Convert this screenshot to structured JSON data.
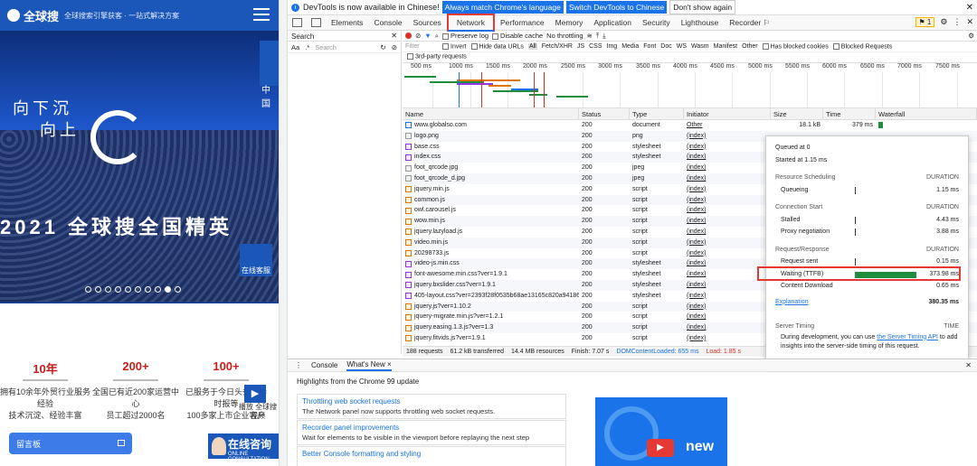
{
  "site": {
    "logo": "全球搜",
    "tagline": "全球搜索引擎获客 · 一站式解决方案",
    "hero": {
      "line1": "向下沉",
      "line2": "向上",
      "banner": "2021 全球搜全国精英",
      "online_service": "在线客服"
    },
    "side_lang": "中国",
    "stats": [
      {
        "badge": "10年",
        "line1": "拥有10余年外贸行业服务",
        "line2": "经验",
        "line3": "技术沉淀、经验丰富"
      },
      {
        "badge": "200+",
        "line1": "全国已有近200家运营中",
        "line2": "心",
        "line3": "员工超过2000名"
      },
      {
        "badge": "100+",
        "line1": "已服务于今日头条、华",
        "line2": "时报等",
        "line3": "100多家上市企业客户"
      }
    ],
    "play_label": "播放 全球搜视频",
    "message_button": "留言板",
    "consult": {
      "title": "在线咨询",
      "sub": "ONLINE CONSULTATION"
    }
  },
  "devtools": {
    "infobar": {
      "text": "DevTools is now available in Chinese!",
      "btn_match": "Always match Chrome's language",
      "btn_switch": "Switch DevTools to Chinese",
      "btn_dont": "Don't show again"
    },
    "tabs": [
      "Elements",
      "Console",
      "Sources",
      "Network",
      "Performance",
      "Memory",
      "Application",
      "Security",
      "Lighthouse",
      "Recorder ⚐"
    ],
    "issues_count": "1",
    "search_pane": {
      "title": "Search",
      "placeholder": "Search"
    },
    "toolbar": {
      "preserve_log": "Preserve log",
      "disable_cache": "Disable cache",
      "throttling": "No throttling"
    },
    "filter": {
      "label": "Filter",
      "invert": "Invert",
      "hide_data": "Hide data URLs",
      "types": [
        "All",
        "Fetch/XHR",
        "JS",
        "CSS",
        "Img",
        "Media",
        "Font",
        "Doc",
        "WS",
        "Wasm",
        "Manifest",
        "Other"
      ],
      "blocked_cookies": "Has blocked cookies",
      "blocked_requests": "Blocked Requests",
      "third_party": "3rd-party requests"
    },
    "overview_ticks": [
      "500 ms",
      "1000 ms",
      "1500 ms",
      "2000 ms",
      "2500 ms",
      "3000 ms",
      "3500 ms",
      "4000 ms",
      "4500 ms",
      "5000 ms",
      "5500 ms",
      "6000 ms",
      "6500 ms",
      "7000 ms",
      "7500 ms"
    ],
    "columns": {
      "name": "Name",
      "status": "Status",
      "type": "Type",
      "initiator": "Initiator",
      "size": "Size",
      "time": "Time",
      "waterfall": "Waterfall"
    },
    "rows": [
      {
        "name": "www.globalso.com",
        "status": "200",
        "type": "document",
        "initiator": "Other",
        "size": "18.1 kB",
        "time": "379 ms"
      },
      {
        "name": "logo.png",
        "status": "200",
        "type": "png",
        "initiator": "(index)",
        "size": "",
        "time": ""
      },
      {
        "name": "base.css",
        "status": "200",
        "type": "stylesheet",
        "initiator": "(index)",
        "size": "",
        "time": ""
      },
      {
        "name": "index.css",
        "status": "200",
        "type": "stylesheet",
        "initiator": "(index)",
        "size": "",
        "time": ""
      },
      {
        "name": "foot_qrcode.jpg",
        "status": "200",
        "type": "jpeg",
        "initiator": "(index)",
        "size": "",
        "time": ""
      },
      {
        "name": "foot_qrcode_d.jpg",
        "status": "200",
        "type": "jpeg",
        "initiator": "(index)",
        "size": "",
        "time": ""
      },
      {
        "name": "jquery.min.js",
        "status": "200",
        "type": "script",
        "initiator": "(index)",
        "size": "",
        "time": ""
      },
      {
        "name": "common.js",
        "status": "200",
        "type": "script",
        "initiator": "(index)",
        "size": "",
        "time": ""
      },
      {
        "name": "owl.carousel.js",
        "status": "200",
        "type": "script",
        "initiator": "(index)",
        "size": "",
        "time": ""
      },
      {
        "name": "wow.min.js",
        "status": "200",
        "type": "script",
        "initiator": "(index)",
        "size": "",
        "time": ""
      },
      {
        "name": "jquery.lazyload.js",
        "status": "200",
        "type": "script",
        "initiator": "(index)",
        "size": "",
        "time": ""
      },
      {
        "name": "video.min.js",
        "status": "200",
        "type": "script",
        "initiator": "(index)",
        "size": "",
        "time": ""
      },
      {
        "name": "20298733.js",
        "status": "200",
        "type": "script",
        "initiator": "(index)",
        "size": "",
        "time": ""
      },
      {
        "name": "video-js.min.css",
        "status": "200",
        "type": "stylesheet",
        "initiator": "(index)",
        "size": "",
        "time": ""
      },
      {
        "name": "font-awesome.min.css?ver=1.9.1",
        "status": "200",
        "type": "stylesheet",
        "initiator": "(index)",
        "size": "",
        "time": ""
      },
      {
        "name": "jquery.bxslider.css?ver=1.9.1",
        "status": "200",
        "type": "stylesheet",
        "initiator": "(index)",
        "size": "",
        "time": ""
      },
      {
        "name": "405-layout.css?ver=2393f28f0535b68ae13165c820a94186",
        "status": "200",
        "type": "stylesheet",
        "initiator": "(index)",
        "size": "",
        "time": ""
      },
      {
        "name": "jquery.js?ver=1.10.2",
        "status": "200",
        "type": "script",
        "initiator": "(index)",
        "size": "",
        "time": ""
      },
      {
        "name": "jquery-migrate.min.js?ver=1.2.1",
        "status": "200",
        "type": "script",
        "initiator": "(index)",
        "size": "",
        "time": ""
      },
      {
        "name": "jquery.easing.1.3.js?ver=1.3",
        "status": "200",
        "type": "script",
        "initiator": "(index)",
        "size": "",
        "time": ""
      },
      {
        "name": "jquery.fitvids.js?ver=1.9.1",
        "status": "200",
        "type": "script",
        "initiator": "(index)",
        "size": "",
        "time": ""
      }
    ],
    "status_bar": {
      "requests": "188 requests",
      "transferred": "61.2 kB transferred",
      "resources": "14.4 MB resources",
      "finish": "Finish: 7.07 s",
      "dcl": "DOMContentLoaded: 655 ms",
      "load": "Load: 1.85 s"
    },
    "timing": {
      "queued": "Queued at 0",
      "started": "Started at 1.15 ms",
      "sections": [
        {
          "title": "Resource Scheduling",
          "dur": "DURATION",
          "items": [
            {
              "label": "Queueing",
              "value": "1.15 ms"
            }
          ]
        },
        {
          "title": "Connection Start",
          "dur": "DURATION",
          "items": [
            {
              "label": "Stalled",
              "value": "4.43 ms"
            },
            {
              "label": "Proxy negotiation",
              "value": "3.88 ms"
            }
          ]
        },
        {
          "title": "Request/Response",
          "dur": "DURATION",
          "items": [
            {
              "label": "Request sent",
              "value": "0.15 ms"
            },
            {
              "label": "Waiting (TTFB)",
              "value": "373.98 ms"
            },
            {
              "label": "Content Download",
              "value": "0.65 ms"
            }
          ]
        }
      ],
      "explanation": "Explanation",
      "total": "380.35 ms",
      "server_timing": "Server Timing",
      "time_label": "TIME",
      "server_text1": "During development, you can use",
      "server_link": "the Server Timing API",
      "server_text2": "to add insights into the server-side timing of this request."
    },
    "drawer": {
      "tabs": [
        "Console",
        "What's New ×"
      ],
      "highlights": "Highlights from the Chrome 99 update",
      "features": [
        {
          "title": "Throttling web socket requests",
          "desc": "The Network panel now supports throttling web socket requests."
        },
        {
          "title": "Recorder panel improvements",
          "desc": "Wait for elements to be visible in the viewport before replaying the next step"
        },
        {
          "title": "Better Console formatting and styling",
          "desc": ""
        }
      ],
      "promo_text": "new"
    }
  }
}
